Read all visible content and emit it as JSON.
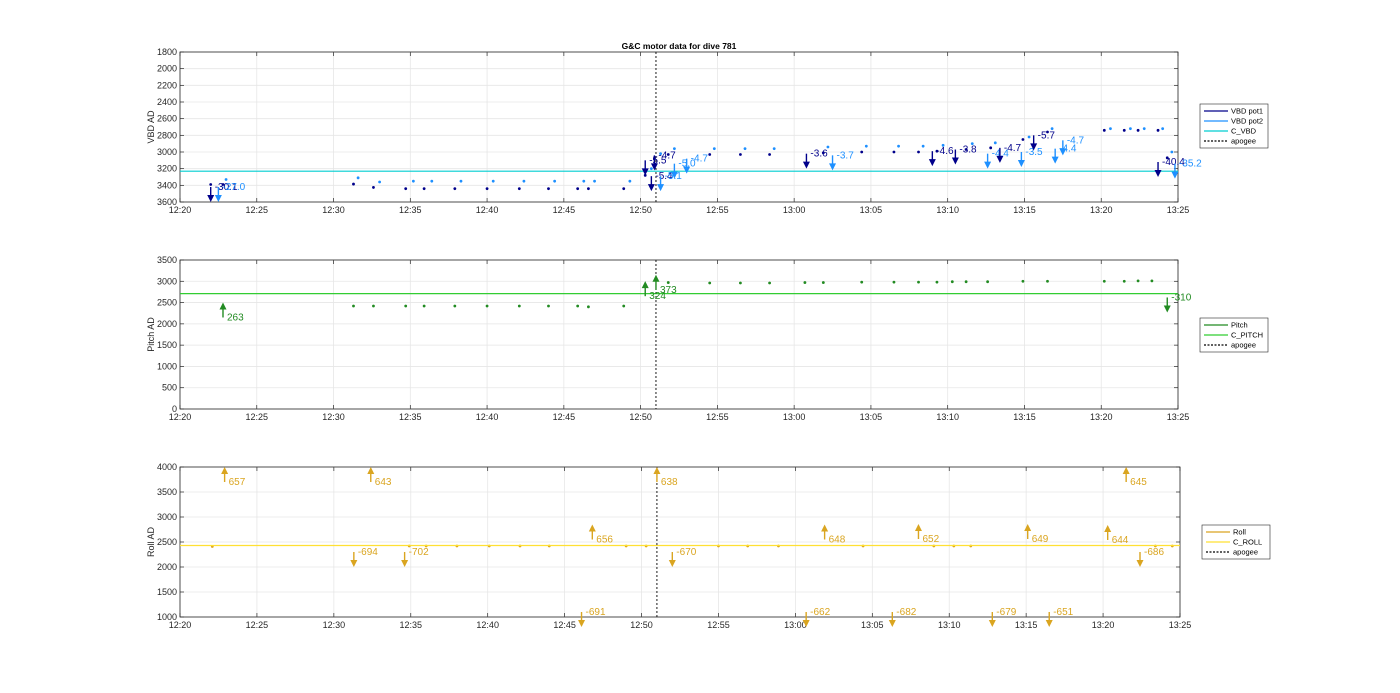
{
  "chart_data": [
    {
      "type": "scatter",
      "title": "G&C motor data for dive 781",
      "ylabel": "VBD AD",
      "x_ticks": [
        "12:20",
        "12:25",
        "12:30",
        "12:35",
        "12:40",
        "12:45",
        "12:50",
        "12:55",
        "13:00",
        "13:05",
        "13:10",
        "13:15",
        "13:20",
        "13:25"
      ],
      "xlim": [
        "12:20",
        "13:25"
      ],
      "ylim": [
        1800,
        3600
      ],
      "y_reversed": true,
      "y_ticks": [
        1800,
        2000,
        2200,
        2400,
        2600,
        2800,
        3000,
        3200,
        3400,
        3600
      ],
      "grid": true,
      "legend_position": "right",
      "colors": {
        "pot1": "#00008b",
        "pot2": "#1e90ff",
        "c": "#00ced1",
        "apogee": "#000000"
      },
      "series": [
        {
          "name": "VBD pot1",
          "points": [
            [
              "12:22.0",
              3390
            ],
            [
              "12:22.8",
              3390
            ],
            [
              "12:31.3",
              3385
            ],
            [
              "12:32.6",
              3425
            ],
            [
              "12:34.7",
              3440
            ],
            [
              "12:35.9",
              3440
            ],
            [
              "12:37.9",
              3440
            ],
            [
              "12:40.0",
              3440
            ],
            [
              "12:42.1",
              3440
            ],
            [
              "12:44.0",
              3440
            ],
            [
              "12:45.9",
              3440
            ],
            [
              "12:46.6",
              3440
            ],
            [
              "12:48.9",
              3440
            ],
            [
              "12:50.3",
              3280
            ],
            [
              "12:50.9",
              3080
            ],
            [
              "12:51.8",
              3030
            ],
            [
              "12:54.5",
              3030
            ],
            [
              "12:56.5",
              3030
            ],
            [
              "12:58.4",
              3030
            ],
            [
              "13:01.9",
              3010
            ],
            [
              "13:04.4",
              3000
            ],
            [
              "13:06.5",
              3000
            ],
            [
              "13:08.1",
              3000
            ],
            [
              "13:09.3",
              2990
            ],
            [
              "13:11.2",
              2970
            ],
            [
              "13:12.8",
              2950
            ],
            [
              "13:14.9",
              2850
            ],
            [
              "13:16.5",
              2760
            ],
            [
              "13:20.2",
              2740
            ],
            [
              "13:21.5",
              2740
            ],
            [
              "13:22.4",
              2740
            ],
            [
              "13:23.7",
              2740
            ],
            [
              "13:24.3",
              3070
            ]
          ]
        },
        {
          "name": "VBD pot2",
          "points": [
            [
              "12:23.0",
              3330
            ],
            [
              "12:31.6",
              3310
            ],
            [
              "12:33.0",
              3360
            ],
            [
              "12:35.2",
              3350
            ],
            [
              "12:36.4",
              3350
            ],
            [
              "12:38.3",
              3350
            ],
            [
              "12:40.4",
              3350
            ],
            [
              "12:42.4",
              3350
            ],
            [
              "12:44.4",
              3350
            ],
            [
              "12:46.3",
              3350
            ],
            [
              "12:47.0",
              3350
            ],
            [
              "12:49.3",
              3350
            ],
            [
              "12:50.7",
              3200
            ],
            [
              "12:51.3",
              3020
            ],
            [
              "12:52.2",
              2960
            ],
            [
              "12:54.8",
              2960
            ],
            [
              "12:56.8",
              2960
            ],
            [
              "12:58.7",
              2960
            ],
            [
              "13:02.2",
              2940
            ],
            [
              "13:04.7",
              2930
            ],
            [
              "13:06.8",
              2930
            ],
            [
              "13:08.4",
              2930
            ],
            [
              "13:09.7",
              2920
            ],
            [
              "13:11.6",
              2900
            ],
            [
              "13:13.1",
              2890
            ],
            [
              "13:15.3",
              2820
            ],
            [
              "13:16.8",
              2720
            ],
            [
              "13:20.6",
              2720
            ],
            [
              "13:21.9",
              2720
            ],
            [
              "13:22.8",
              2720
            ],
            [
              "13:24.0",
              2720
            ],
            [
              "13:24.6",
              3000
            ]
          ]
        },
        {
          "name": "C_VBD",
          "value": 3230
        },
        {
          "name": "apogee",
          "x": "12:51.0"
        }
      ],
      "annotations": [
        {
          "x": "12:22.0",
          "y": 3420,
          "text": "-30.1",
          "color": "#00008b"
        },
        {
          "x": "12:22.5",
          "y": 3420,
          "text": "-27.0",
          "color": "#1e90ff"
        },
        {
          "x": "12:50.3",
          "y": 3100,
          "text": "-5.5",
          "color": "#00008b"
        },
        {
          "x": "12:50.9",
          "y": 3040,
          "text": "-4.7",
          "color": "#00008b"
        },
        {
          "x": "12:50.7",
          "y": 3290,
          "text": "-5.4",
          "color": "#00008b"
        },
        {
          "x": "12:51.3",
          "y": 3290,
          "text": "-5.1",
          "color": "#1e90ff"
        },
        {
          "x": "12:52.2",
          "y": 3140,
          "text": "-5.0",
          "color": "#1e90ff"
        },
        {
          "x": "12:53.0",
          "y": 3080,
          "text": "-4.7",
          "color": "#1e90ff"
        },
        {
          "x": "13:00.8",
          "y": 3020,
          "text": "-3.6",
          "color": "#00008b"
        },
        {
          "x": "13:02.5",
          "y": 3040,
          "text": "-3.7",
          "color": "#1e90ff"
        },
        {
          "x": "13:09.0",
          "y": 2990,
          "text": "-4.6",
          "color": "#00008b"
        },
        {
          "x": "13:10.5",
          "y": 2970,
          "text": "-3.8",
          "color": "#00008b"
        },
        {
          "x": "13:12.6",
          "y": 3020,
          "text": "-4.4",
          "color": "#1e90ff"
        },
        {
          "x": "13:13.4",
          "y": 2950,
          "text": "-4.7",
          "color": "#00008b"
        },
        {
          "x": "13:14.8",
          "y": 3000,
          "text": "-3.5",
          "color": "#1e90ff"
        },
        {
          "x": "13:15.6",
          "y": 2800,
          "text": "-5.7",
          "color": "#00008b"
        },
        {
          "x": "13:17.0",
          "y": 2960,
          "text": "-4.4",
          "color": "#1e90ff"
        },
        {
          "x": "13:17.5",
          "y": 2860,
          "text": "-4.7",
          "color": "#1e90ff"
        },
        {
          "x": "13:23.7",
          "y": 3120,
          "text": "-40.4",
          "color": "#00008b"
        },
        {
          "x": "13:24.8",
          "y": 3140,
          "text": "-35.2",
          "color": "#1e90ff"
        }
      ]
    },
    {
      "type": "scatter",
      "ylabel": "Pitch AD",
      "x_ticks": [
        "12:20",
        "12:25",
        "12:30",
        "12:35",
        "12:40",
        "12:45",
        "12:50",
        "12:55",
        "13:00",
        "13:05",
        "13:10",
        "13:15",
        "13:20",
        "13:25"
      ],
      "xlim": [
        "12:20",
        "13:25"
      ],
      "ylim": [
        0,
        3500
      ],
      "y_ticks": [
        0,
        500,
        1000,
        1500,
        2000,
        2500,
        3000,
        3500
      ],
      "grid": true,
      "legend_position": "right",
      "colors": {
        "pitch": "#228b22",
        "c": "#32cd32",
        "apogee": "#000000"
      },
      "series": [
        {
          "name": "Pitch",
          "points": [
            [
              "12:31.3",
              2420
            ],
            [
              "12:32.6",
              2420
            ],
            [
              "12:34.7",
              2420
            ],
            [
              "12:35.9",
              2420
            ],
            [
              "12:37.9",
              2420
            ],
            [
              "12:40.0",
              2420
            ],
            [
              "12:42.1",
              2420
            ],
            [
              "12:44.0",
              2420
            ],
            [
              "12:45.9",
              2420
            ],
            [
              "12:46.6",
              2400
            ],
            [
              "12:48.9",
              2420
            ],
            [
              "12:51.8",
              2970
            ],
            [
              "12:54.5",
              2960
            ],
            [
              "12:56.5",
              2960
            ],
            [
              "12:58.4",
              2960
            ],
            [
              "13:00.7",
              2970
            ],
            [
              "13:01.9",
              2970
            ],
            [
              "13:04.4",
              2980
            ],
            [
              "13:06.5",
              2980
            ],
            [
              "13:08.1",
              2980
            ],
            [
              "13:09.3",
              2980
            ],
            [
              "13:10.3",
              2990
            ],
            [
              "13:11.2",
              2990
            ],
            [
              "13:12.6",
              2990
            ],
            [
              "13:14.9",
              3000
            ],
            [
              "13:16.5",
              3000
            ],
            [
              "13:20.2",
              3000
            ],
            [
              "13:21.5",
              3000
            ],
            [
              "13:22.4",
              3010
            ],
            [
              "13:23.3",
              3010
            ]
          ]
        },
        {
          "name": "C_PITCH",
          "value": 2710
        },
        {
          "name": "apogee",
          "x": "12:51.0"
        }
      ],
      "annotations": [
        {
          "x": "12:22.8",
          "y": 2150,
          "text": "263",
          "color": "#228b22"
        },
        {
          "x": "12:50.3",
          "y": 2650,
          "text": "324",
          "color": "#228b22"
        },
        {
          "x": "12:51.0",
          "y": 2800,
          "text": "373",
          "color": "#228b22"
        },
        {
          "x": "13:24.3",
          "y": 2620,
          "text": "-310",
          "color": "#228b22"
        }
      ]
    },
    {
      "type": "scatter",
      "ylabel": "Roll AD",
      "x_ticks": [
        "12:20",
        "12:25",
        "12:30",
        "12:35",
        "12:40",
        "12:45",
        "12:50",
        "12:55",
        "13:00",
        "13:05",
        "13:10",
        "13:15",
        "13:20",
        "13:25"
      ],
      "xlim": [
        "12:20",
        "13:25"
      ],
      "ylim": [
        1000,
        4000
      ],
      "y_ticks": [
        1000,
        1500,
        2000,
        2500,
        3000,
        3500,
        4000
      ],
      "grid": true,
      "legend_position": "right",
      "colors": {
        "roll": "#daa520",
        "c": "#ffe033",
        "apogee": "#000000"
      },
      "series": [
        {
          "name": "Roll",
          "points": [
            [
              "12:22.1",
              2410
            ],
            [
              "12:34.9",
              2420
            ],
            [
              "12:36.0",
              2420
            ],
            [
              "12:38.0",
              2420
            ],
            [
              "12:40.1",
              2420
            ],
            [
              "12:42.1",
              2420
            ],
            [
              "12:44.0",
              2420
            ],
            [
              "12:49.0",
              2420
            ],
            [
              "12:50.3",
              2420
            ],
            [
              "12:55.0",
              2420
            ],
            [
              "12:56.9",
              2420
            ],
            [
              "12:58.9",
              2420
            ],
            [
              "13:04.4",
              2420
            ],
            [
              "13:09.0",
              2420
            ],
            [
              "13:10.3",
              2420
            ],
            [
              "13:11.4",
              2420
            ],
            [
              "13:23.4",
              2420
            ],
            [
              "13:24.5",
              2420
            ]
          ]
        },
        {
          "name": "C_ROLL",
          "value": 2430
        },
        {
          "name": "apogee",
          "x": "12:51.0"
        }
      ],
      "annotations": [
        {
          "x": "12:22.9",
          "y": 3700,
          "text": "657",
          "color": "#daa520"
        },
        {
          "x": "12:31.3",
          "y": 2300,
          "text": "-694",
          "color": "#daa520"
        },
        {
          "x": "12:32.4",
          "y": 3700,
          "text": "643",
          "color": "#daa520"
        },
        {
          "x": "12:34.6",
          "y": 2300,
          "text": "-702",
          "color": "#daa520"
        },
        {
          "x": "12:46.1",
          "y": 1100,
          "text": "-691",
          "color": "#daa520"
        },
        {
          "x": "12:46.8",
          "y": 2550,
          "text": "656",
          "color": "#daa520"
        },
        {
          "x": "12:51.0",
          "y": 3700,
          "text": "638",
          "color": "#daa520"
        },
        {
          "x": "12:52.0",
          "y": 2300,
          "text": "-670",
          "color": "#daa520"
        },
        {
          "x": "13:00.7",
          "y": 1100,
          "text": "-662",
          "color": "#daa520"
        },
        {
          "x": "13:01.9",
          "y": 2550,
          "text": "648",
          "color": "#daa520"
        },
        {
          "x": "13:06.3",
          "y": 1100,
          "text": "-682",
          "color": "#daa520"
        },
        {
          "x": "13:08.0",
          "y": 2560,
          "text": "652",
          "color": "#daa520"
        },
        {
          "x": "13:12.8",
          "y": 1100,
          "text": "-679",
          "color": "#daa520"
        },
        {
          "x": "13:15.1",
          "y": 2560,
          "text": "649",
          "color": "#daa520"
        },
        {
          "x": "13:16.5",
          "y": 1100,
          "text": "-651",
          "color": "#daa520"
        },
        {
          "x": "13:20.3",
          "y": 2540,
          "text": "644",
          "color": "#daa520"
        },
        {
          "x": "13:21.5",
          "y": 3700,
          "text": "645",
          "color": "#daa520"
        },
        {
          "x": "13:22.4",
          "y": 2300,
          "text": "-686",
          "color": "#daa520"
        }
      ]
    }
  ],
  "legends": [
    [
      "VBD pot1",
      "VBD pot2",
      "C_VBD",
      "apogee"
    ],
    [
      "Pitch",
      "C_PITCH",
      "apogee"
    ],
    [
      "Roll",
      "C_ROLL",
      "apogee"
    ]
  ]
}
